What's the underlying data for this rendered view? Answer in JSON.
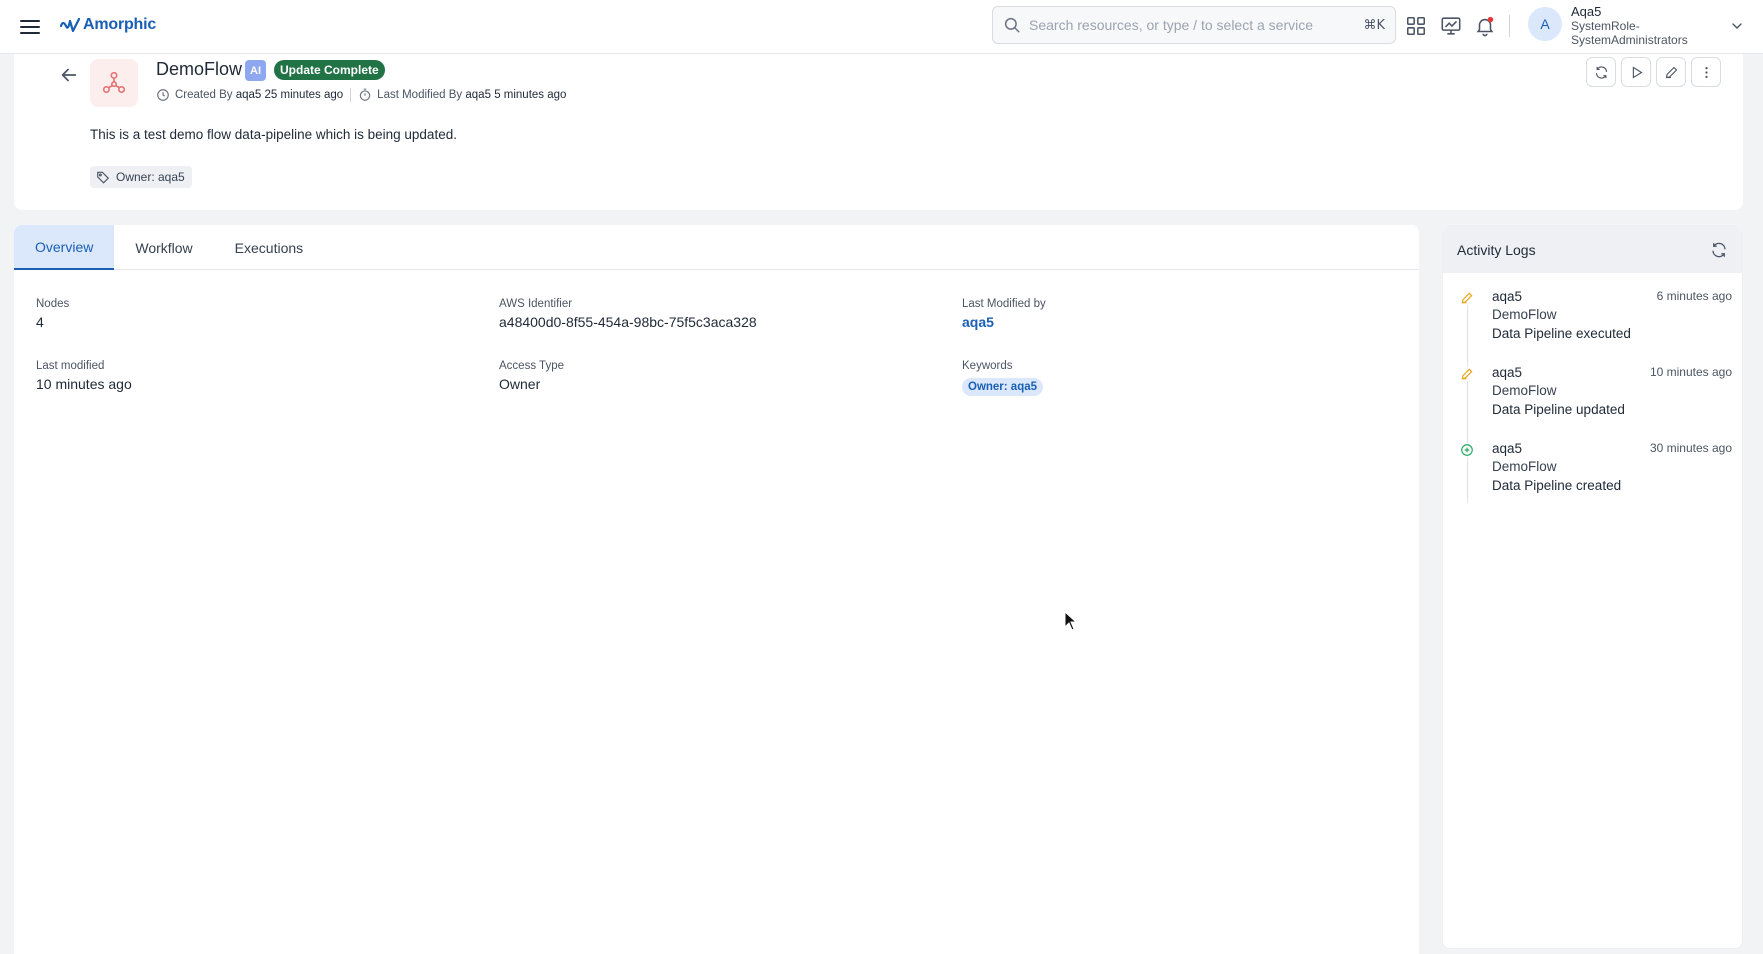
{
  "topbar": {
    "brand": "Amorphic",
    "search_placeholder": "Search resources, or type / to select a service",
    "search_shortcut": "⌘K",
    "user": {
      "initial": "A",
      "name": "Aqa5",
      "role": "SystemRole-SystemAdministrators"
    }
  },
  "header": {
    "title": "DemoFlow",
    "ai_badge": "AI",
    "status": "Update Complete",
    "created_label": "Created By",
    "created_by": "aqa5",
    "created_ago": "25 minutes ago",
    "modified_label": "Last Modified By",
    "modified_by": "aqa5",
    "modified_ago": "5 minutes ago",
    "description": "This is a test demo flow data-pipeline which is being updated.",
    "owner_tag": "Owner: aqa5"
  },
  "tabs": [
    {
      "label": "Overview",
      "active": true
    },
    {
      "label": "Workflow",
      "active": false
    },
    {
      "label": "Executions",
      "active": false
    }
  ],
  "overview": {
    "nodes": {
      "label": "Nodes",
      "value": "4"
    },
    "aws_identifier": {
      "label": "AWS Identifier",
      "value": "a48400d0-8f55-454a-98bc-75f5c3aca328"
    },
    "last_modified_by": {
      "label": "Last Modified by",
      "value": "aqa5"
    },
    "last_modified": {
      "label": "Last modified",
      "value": "10 minutes ago"
    },
    "access_type": {
      "label": "Access Type",
      "value": "Owner"
    },
    "keywords": {
      "label": "Keywords",
      "values": [
        "Owner: aqa5"
      ]
    }
  },
  "activity": {
    "title": "Activity Logs",
    "items": [
      {
        "icon": "pencil-icon",
        "user": "aqa5",
        "time": "6 minutes ago",
        "entity": "DemoFlow",
        "action": "Data Pipeline executed",
        "color": "#e8a317"
      },
      {
        "icon": "pencil-icon",
        "user": "aqa5",
        "time": "10 minutes ago",
        "entity": "DemoFlow",
        "action": "Data Pipeline updated",
        "color": "#e8a317"
      },
      {
        "icon": "plus-circle-icon",
        "user": "aqa5",
        "time": "30 minutes ago",
        "entity": "DemoFlow",
        "action": "Data Pipeline created",
        "color": "#22a861"
      }
    ]
  },
  "colors": {
    "accent": "#1a5fb4",
    "status_green": "#217346",
    "ai_badge": "#8ea8ef",
    "tab_active_bg": "#dbe8fb"
  }
}
